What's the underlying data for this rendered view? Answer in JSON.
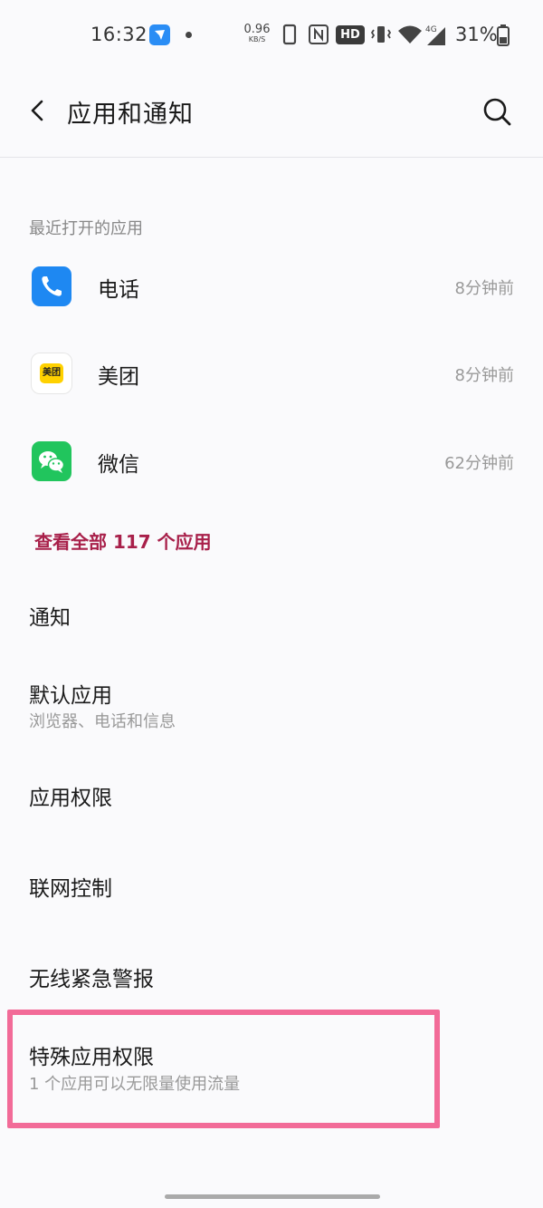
{
  "status_bar": {
    "time": "16:32",
    "net_speed_value": "0.96",
    "net_speed_unit": "KB/S",
    "hd_label": "HD",
    "network_type": "4G",
    "battery_percent": "31%"
  },
  "header": {
    "title": "应用和通知"
  },
  "recent": {
    "section_label": "最近打开的应用",
    "apps": [
      {
        "name": "电话",
        "time": "8分钟前",
        "icon": "phone-icon",
        "color": "#1e88f2"
      },
      {
        "name": "美团",
        "time": "8分钟前",
        "icon": "meituan-icon",
        "color": "#ffd100",
        "icon_text": "美团"
      },
      {
        "name": "微信",
        "time": "62分钟前",
        "icon": "wechat-icon",
        "color": "#21c55d"
      }
    ],
    "view_all_label": "查看全部 117 个应用"
  },
  "menu": {
    "notifications": {
      "title": "通知"
    },
    "default_apps": {
      "title": "默认应用",
      "subtitle": "浏览器、电话和信息"
    },
    "app_permissions": {
      "title": "应用权限"
    },
    "network_control": {
      "title": "联网控制"
    },
    "wireless_alerts": {
      "title": "无线紧急警报"
    },
    "special_access": {
      "title": "特殊应用权限",
      "subtitle": "1 个应用可以无限量使用流量"
    }
  },
  "colors": {
    "accent": "#a8204a",
    "highlight": "#f26b98",
    "background": "#fafafc"
  }
}
